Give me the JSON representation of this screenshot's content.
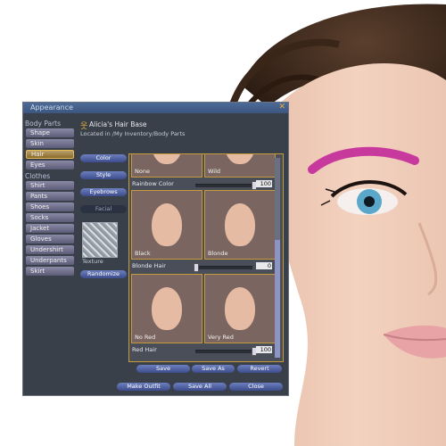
{
  "window": {
    "title": "Appearance",
    "close_glyph": "✕"
  },
  "sidebar": {
    "body_parts_label": "Body Parts",
    "body_parts": [
      {
        "label": "Shape"
      },
      {
        "label": "Skin"
      },
      {
        "label": "Hair",
        "active": true
      },
      {
        "label": "Eyes"
      }
    ],
    "clothes_label": "Clothes",
    "clothes": [
      {
        "label": "Shirt"
      },
      {
        "label": "Pants"
      },
      {
        "label": "Shoes"
      },
      {
        "label": "Socks"
      },
      {
        "label": "Jacket"
      },
      {
        "label": "Gloves"
      },
      {
        "label": "Undershirt"
      },
      {
        "label": "Underpants"
      },
      {
        "label": "Skirt"
      }
    ]
  },
  "item": {
    "icon": "person-icon",
    "name": "Alicia's Hair Base",
    "location": "Located in /My Inventory/Body Parts"
  },
  "tabs": {
    "color": "Color",
    "style": "Style",
    "eyebrows": "Eyebrows",
    "facial": "Facial"
  },
  "texture_label": "Texture",
  "randomize_label": "Randomize",
  "params": [
    {
      "left": "None",
      "right": "Wild",
      "slider_label": "Rainbow Color",
      "value": "100",
      "level": 1.0
    },
    {
      "left": "Black",
      "right": "Blonde",
      "slider_label": "Blonde Hair",
      "value": "0",
      "level": 0.0
    },
    {
      "left": "No Red",
      "right": "Very Red",
      "slider_label": "Red Hair",
      "value": "100",
      "level": 1.0
    }
  ],
  "actions": {
    "save": "Save",
    "save_as": "Save As",
    "revert": "Revert"
  },
  "footer": {
    "make_outfit": "Make Outfit",
    "save_all": "Save All",
    "close": "Close"
  },
  "colors": {
    "accent_gold": "#c59a3a",
    "eyebrow_magenta": "#c8399e",
    "iris_blue": "#5aa7c9"
  }
}
